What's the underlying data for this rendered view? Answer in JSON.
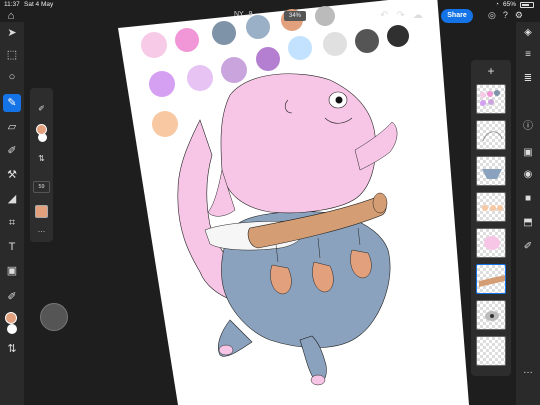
{
  "status": {
    "time": "11:37",
    "date": "Sat 4 May",
    "battery": "65%"
  },
  "doc": {
    "name": "NY...9",
    "zoom": "34%"
  },
  "toolbar": {
    "share_label": "Share"
  },
  "brush": {
    "size": "59"
  },
  "colors": {
    "accent": "#1473e6",
    "foreground": "#e2a07d",
    "background": "#ffffff"
  },
  "tools": [
    "select-tool",
    "transform-tool",
    "lasso-tool",
    "brush-tool",
    "eraser-tool",
    "smudge-tool",
    "clone-tool",
    "fill-tool",
    "crop-tool",
    "type-tool",
    "place-image-tool",
    "eyedropper-tool"
  ],
  "right_panel": [
    "layers-icon",
    "layer-properties-icon",
    "adjustments-icon",
    "info-icon",
    "add-mask-icon",
    "visibility-icon",
    "mask-icon",
    "merge-icon",
    "paint-icon"
  ],
  "layers": [
    "palette",
    "sketch",
    "blue-body",
    "orange-spots",
    "pink-creature",
    "brown-belt",
    "eye-detail",
    "blank"
  ]
}
